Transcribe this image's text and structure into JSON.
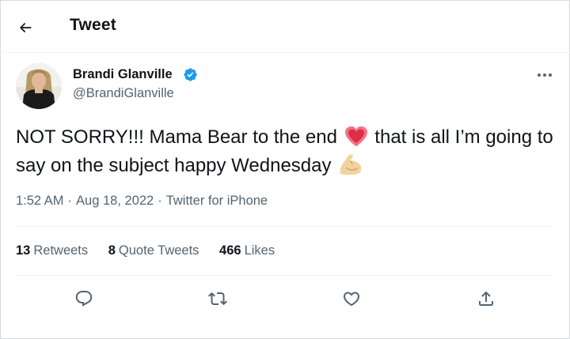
{
  "header": {
    "title": "Tweet",
    "back_icon": "arrow-left-icon"
  },
  "author": {
    "name": "Brandi Glanville",
    "handle": "@BrandiGlanville",
    "verified_icon": "verified-badge-icon"
  },
  "tweet": {
    "text_part1": "NOT SORRY!!! Mama Bear to the end",
    "emoji1": "sparkling-heart-emoji",
    "text_part2": " that is all I’m going to say on the subject happy Wednesday",
    "emoji2": "flexed-biceps-emoji"
  },
  "meta": {
    "time": "1:52 AM",
    "separator": "·",
    "date": "Aug 18, 2022",
    "source": "Twitter for iPhone"
  },
  "stats": {
    "retweets_count": "13",
    "retweets_label": "Retweets",
    "quotes_count": "8",
    "quotes_label": "Quote Tweets",
    "likes_count": "466",
    "likes_label": "Likes"
  },
  "actions": [
    "reply-icon",
    "retweet-icon",
    "like-icon",
    "share-icon"
  ],
  "colors": {
    "text": "#0f1419",
    "secondary": "#536471",
    "divider": "#eff3f4",
    "verified": "#1d9bf0"
  }
}
